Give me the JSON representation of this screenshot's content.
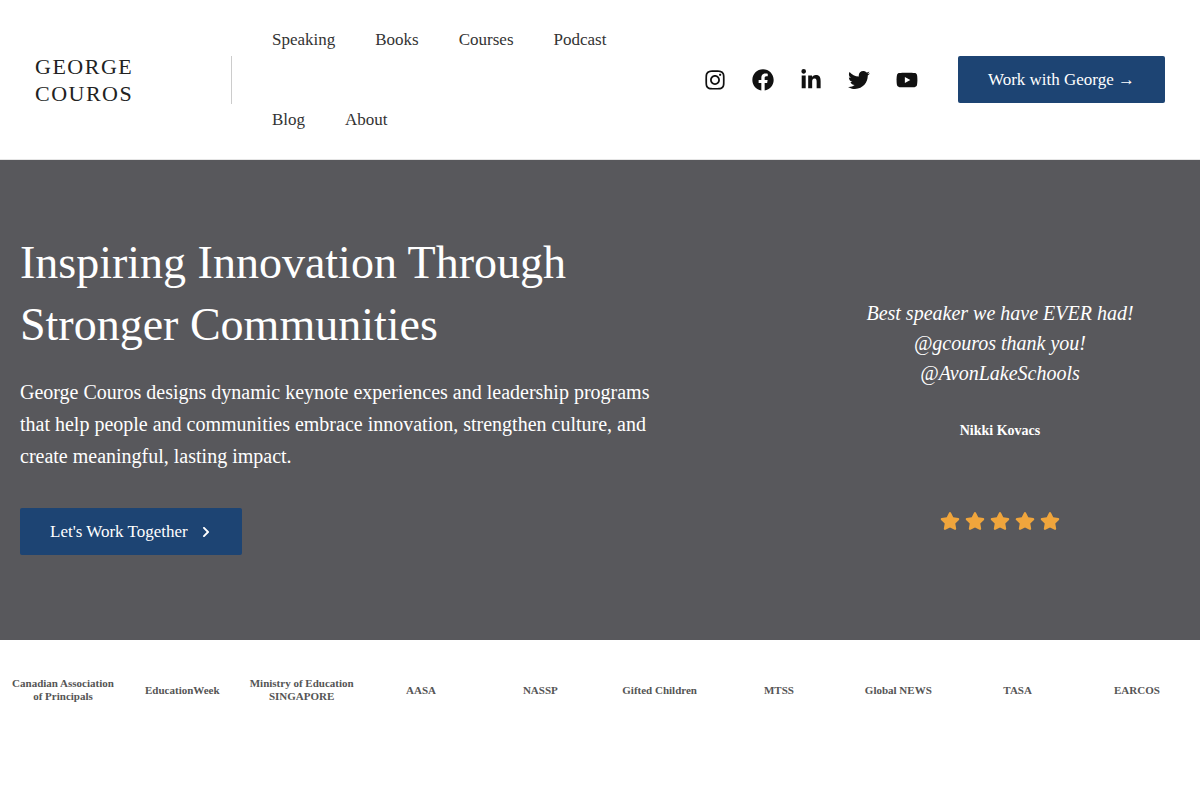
{
  "header": {
    "logo": "GEORGE COUROS",
    "nav": [
      "Speaking",
      "Books",
      "Courses",
      "Podcast",
      "Blog",
      "About"
    ],
    "cta": "Work with George →"
  },
  "hero": {
    "title": "Inspiring Innovation Through Stronger Communities",
    "body": "George Couros designs dynamic keynote experiences and leadership programs that help people and communities embrace innovation, strengthen culture, and create meaningful, lasting impact.",
    "button": "Let's Work Together",
    "testimonial": {
      "quote": [
        "Best speaker we have EVER had!",
        "@gcouros thank you!",
        "@AvonLakeSchools"
      ],
      "author": "Nikki Kovacs",
      "stars": 5
    }
  },
  "logos": [
    "Canadian Association of Principals",
    "EducationWeek",
    "Ministry of Education SINGAPORE",
    "AASA",
    "NASSP",
    "Gifted Children",
    "MTSS",
    "Global NEWS",
    "TASA",
    "EARCOS"
  ]
}
